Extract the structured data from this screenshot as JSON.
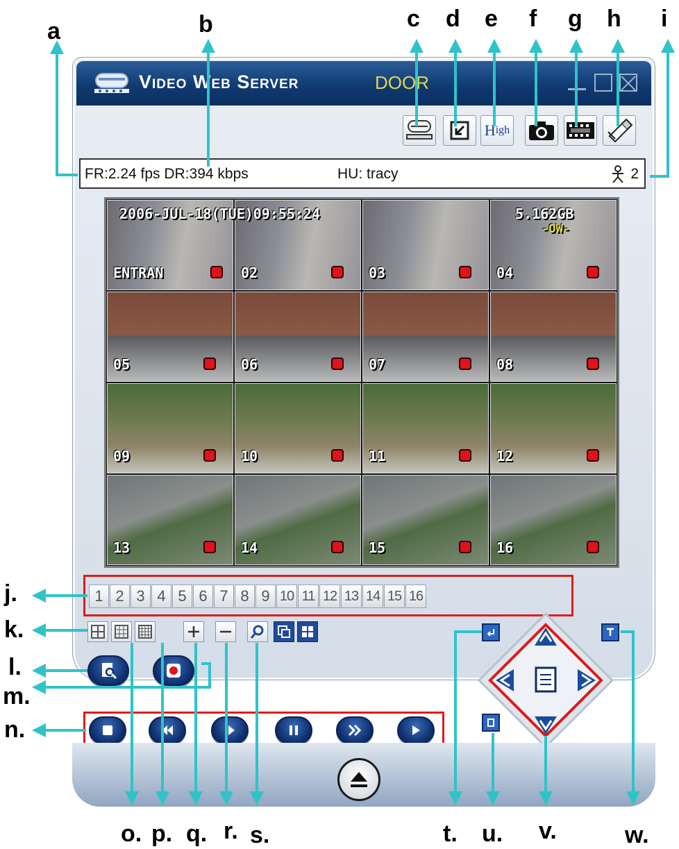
{
  "callouts": {
    "a": "a",
    "b": "b",
    "c": "c",
    "d": "d",
    "e": "e",
    "f": "f",
    "g": "g",
    "h": "h",
    "i": "i",
    "j": "j.",
    "k": "k.",
    "l": "l.",
    "m": "m.",
    "n": "n.",
    "o": "o.",
    "p": "p.",
    "q": "q.",
    "r": "r.",
    "s": "s.",
    "t": "t.",
    "u": "u.",
    "v": "v.",
    "w": "w."
  },
  "window": {
    "title": "Video Web Server",
    "camera_name": "DOOR"
  },
  "toolbar": {
    "icons": [
      "network-icon",
      "minimize-view-icon",
      "quality-high",
      "snapshot-icon",
      "record-film-icon",
      "settings-icon"
    ],
    "quality_main": "H",
    "quality_rest": "igh"
  },
  "status": {
    "frame_data_rate": "FR:2.24 fps DR:394 kbps",
    "user": "HU: tracy",
    "online_users": "2"
  },
  "video": {
    "datetime": "2006-JUL-18(TUE)09:55:24",
    "disk": "5.162GB",
    "overwrite": "-OW-",
    "cameras": [
      "ENTRAN",
      "02",
      "03",
      "04",
      "05",
      "06",
      "07",
      "08",
      "09",
      "10",
      "11",
      "12",
      "13",
      "14",
      "15",
      "16"
    ]
  },
  "channels": [
    "1",
    "2",
    "3",
    "4",
    "5",
    "6",
    "7",
    "8",
    "9",
    "10",
    "11",
    "12",
    "13",
    "14",
    "15",
    "16"
  ],
  "layout_buttons": [
    "4-split",
    "9-split",
    "16-split",
    "zoom-in",
    "zoom-out",
    "zoom",
    "pip",
    "quad"
  ],
  "colors": {
    "title_bg": "#103a72",
    "camera_name": "#e3d84a",
    "callout_arrow": "#2fc3c8",
    "highlight": "#e01b1b",
    "button_blue": "#0d2e6d"
  }
}
